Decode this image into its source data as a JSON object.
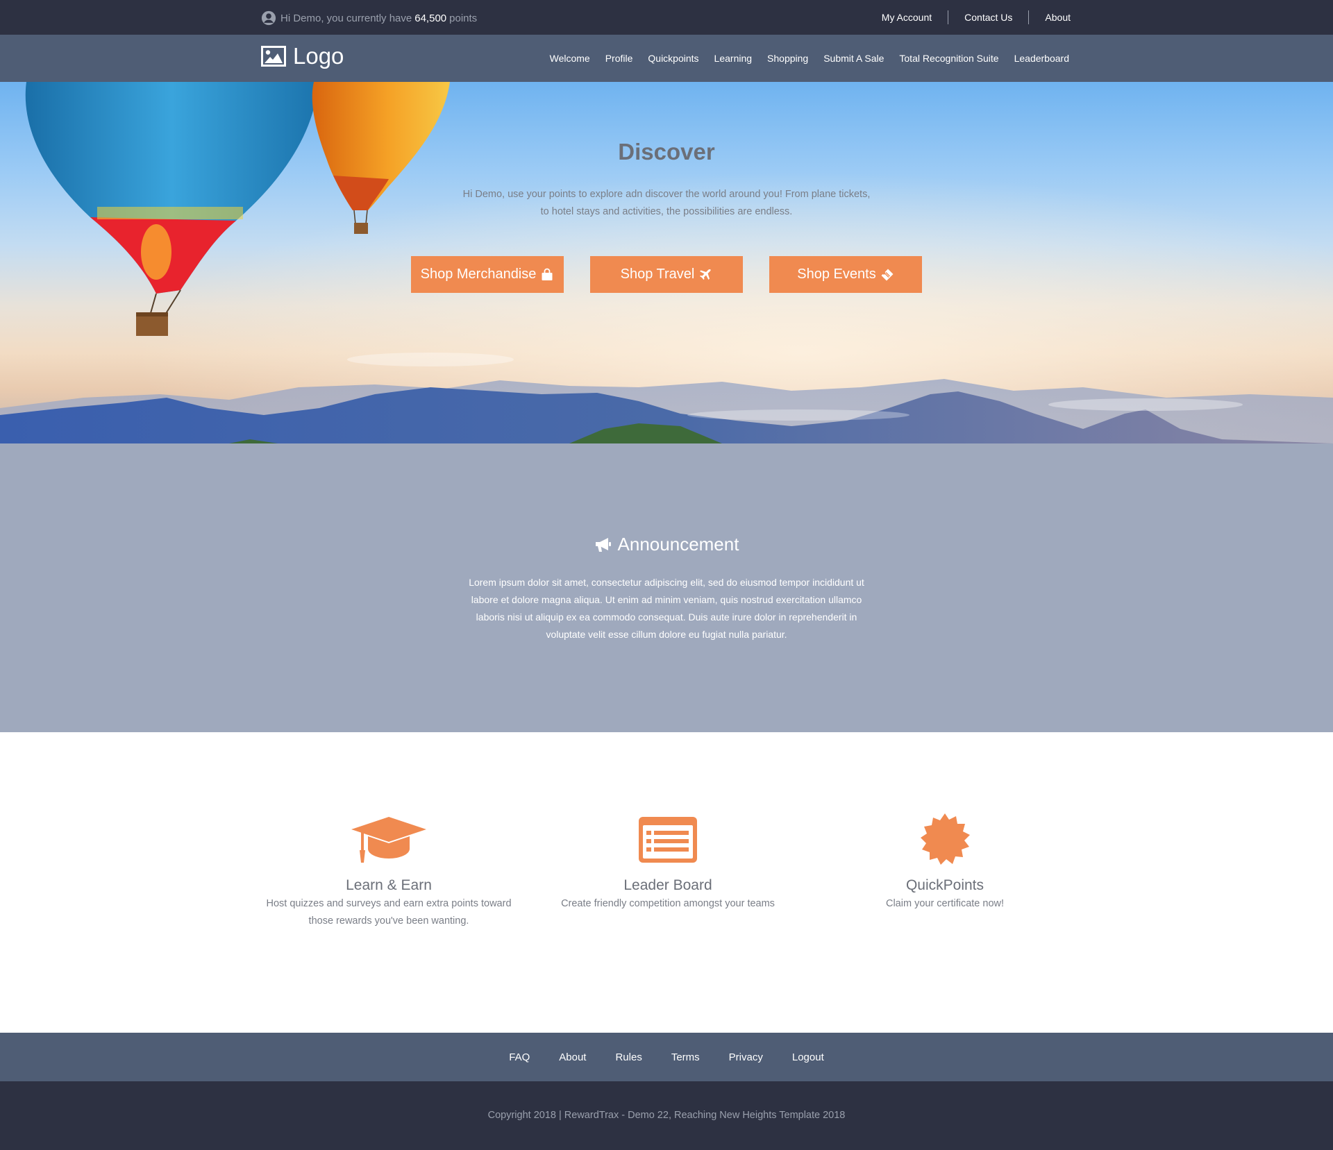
{
  "topbar": {
    "greeting_prefix": "Hi Demo, you currently have",
    "points": "64,500",
    "greeting_suffix": "points",
    "links": [
      "My Account",
      "Contact Us",
      "About"
    ]
  },
  "navbar": {
    "logo_text": "Logo",
    "items": [
      "Welcome",
      "Profile",
      "Quickpoints",
      "Learning",
      "Shopping",
      "Submit A Sale",
      "Total Recognition Suite",
      "Leaderboard"
    ]
  },
  "hero": {
    "title": "Discover",
    "text": "Hi Demo, use your points to explore adn discover the world around you! From plane tickets, to hotel stays and activities, the possibilities are endless.",
    "buttons": [
      {
        "label": "Shop Merchandise",
        "icon": "shopping-bag-icon"
      },
      {
        "label": "Shop Travel",
        "icon": "plane-icon"
      },
      {
        "label": "Shop Events",
        "icon": "ticket-icon"
      }
    ]
  },
  "announcement": {
    "title": "Announcement",
    "icon": "megaphone-icon",
    "text": "Lorem ipsum dolor sit amet, consectetur adipiscing elit, sed do eiusmod tempor incididunt ut labore et dolore magna aliqua. Ut enim ad minim veniam, quis nostrud exercitation ullamco laboris nisi ut aliquip ex ea commodo consequat. Duis aute irure dolor in reprehenderit in voluptate velit esse cillum dolore eu fugiat nulla pariatur."
  },
  "features": [
    {
      "title": "Learn & Earn",
      "text": "Host quizzes and surveys and earn extra points toward those rewards you've been wanting.",
      "icon": "graduation-cap-icon"
    },
    {
      "title": "Leader Board",
      "text": "Create friendly competition amongst your teams",
      "icon": "list-icon"
    },
    {
      "title": "QuickPoints",
      "text": "Claim your certificate now!",
      "icon": "certificate-icon"
    }
  ],
  "footer": {
    "links": [
      "FAQ",
      "About",
      "Rules",
      "Terms",
      "Privacy",
      "Logout"
    ],
    "copyright": "Copyright 2018 | RewardTrax - Demo 22, Reaching New Heights Template 2018"
  },
  "colors": {
    "accent": "#f08a50",
    "topbar": "#2d3142",
    "navbar": "#4f5d75",
    "announcement_bg": "#9fa9bd"
  }
}
